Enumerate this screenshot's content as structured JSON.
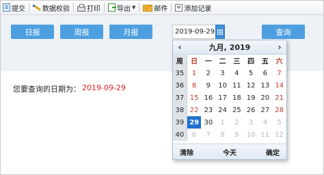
{
  "toolbar": {
    "items": [
      {
        "label": "提交",
        "icon": "submit-icon"
      },
      {
        "label": "数据校验",
        "icon": "check-icon"
      },
      {
        "label": "打印",
        "icon": "print-icon"
      },
      {
        "label": "导出",
        "icon": "export-icon",
        "dropdown": true
      },
      {
        "label": "邮件",
        "icon": "mail-icon"
      },
      {
        "label": "添加记录",
        "icon": "add-record-icon"
      }
    ]
  },
  "filters": {
    "daily_label": "日报",
    "weekly_label": "周报",
    "monthly_label": "月报",
    "date_value": "2019-09-29",
    "query_label": "查询"
  },
  "result": {
    "label": "您要查询的日期为：",
    "value": "2019-09-29"
  },
  "calendar": {
    "title": "九月, 2019",
    "prev": "‹",
    "next": "›",
    "week_header": "周",
    "weekdays": [
      "日",
      "一",
      "二",
      "三",
      "四",
      "五",
      "六"
    ],
    "rows": [
      {
        "week": "35",
        "days": [
          "1",
          "2",
          "3",
          "4",
          "5",
          "6",
          "7"
        ]
      },
      {
        "week": "36",
        "days": [
          "8",
          "9",
          "10",
          "11",
          "12",
          "13",
          "14"
        ]
      },
      {
        "week": "37",
        "days": [
          "15",
          "16",
          "17",
          "18",
          "19",
          "20",
          "21"
        ]
      },
      {
        "week": "38",
        "days": [
          "22",
          "23",
          "24",
          "25",
          "26",
          "27",
          "28"
        ]
      },
      {
        "week": "39",
        "days": [
          "29",
          "30",
          "1",
          "2",
          "3",
          "4",
          "5"
        ]
      },
      {
        "week": "40",
        "days": [
          "6",
          "7",
          "8",
          "9",
          "10",
          "11",
          "12"
        ]
      }
    ],
    "selected_day": "29",
    "clear_label": "清除",
    "today_label": "今天",
    "ok_label": "确定"
  },
  "colors": {
    "button_blue": "#4d9fe0",
    "selected_blue": "#1f6fd1",
    "weekend_red": "#c0392b",
    "result_red": "#e02020"
  }
}
